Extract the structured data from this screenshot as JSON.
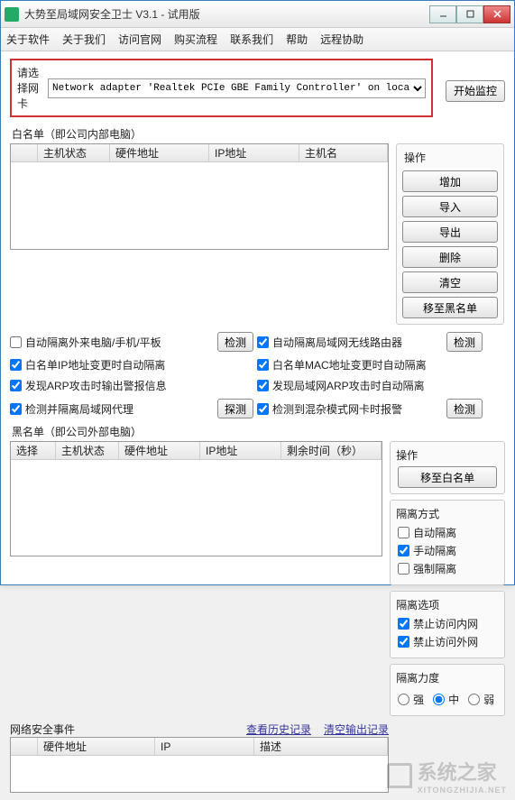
{
  "window": {
    "title": "大势至局域网安全卫士 V3.1 - 试用版"
  },
  "menu": [
    "关于软件",
    "关于我们",
    "访问官网",
    "购买流程",
    "联系我们",
    "帮助",
    "远程协助"
  ],
  "adapter": {
    "label": "请选择网卡",
    "selected": "Network adapter 'Realtek PCIe GBE Family Controller' on loca",
    "start_btn": "开始监控"
  },
  "whitelist": {
    "label": "白名单（即公司内部电脑）",
    "columns": [
      "主机状态",
      "硬件地址",
      "IP地址",
      "主机名"
    ],
    "ops_title": "操作",
    "ops": [
      "增加",
      "导入",
      "导出",
      "删除",
      "清空",
      "移至黑名单"
    ]
  },
  "options": [
    {
      "checked": false,
      "text": "自动隔离外来电脑/手机/平板",
      "btn": "检测"
    },
    {
      "checked": true,
      "text": "自动隔离局域网无线路由器",
      "btn": "检测"
    },
    {
      "checked": true,
      "text": "白名单IP地址变更时自动隔离"
    },
    {
      "checked": true,
      "text": "白名单MAC地址变更时自动隔离"
    },
    {
      "checked": true,
      "text": "发现ARP攻击时输出警报信息"
    },
    {
      "checked": true,
      "text": "发现局域网ARP攻击时自动隔离"
    },
    {
      "checked": true,
      "text": "检测并隔离局域网代理",
      "btn": "探测"
    },
    {
      "checked": true,
      "text": "检测到混杂模式网卡时报警",
      "btn": "检测"
    }
  ],
  "blacklist": {
    "label": "黑名单（即公司外部电脑）",
    "columns": [
      "选择",
      "主机状态",
      "硬件地址",
      "IP地址",
      "剩余时间（秒）"
    ],
    "ops_title": "操作",
    "move_btn": "移至白名单"
  },
  "iso_mode": {
    "title": "隔离方式",
    "items": [
      {
        "checked": false,
        "text": "自动隔离"
      },
      {
        "checked": true,
        "text": "手动隔离"
      },
      {
        "checked": false,
        "text": "强制隔离"
      }
    ]
  },
  "iso_opts": {
    "title": "隔离选项",
    "items": [
      {
        "checked": true,
        "text": "禁止访问内网"
      },
      {
        "checked": true,
        "text": "禁止访问外网"
      }
    ]
  },
  "iso_level": {
    "title": "隔离力度",
    "items": [
      "强",
      "中",
      "弱"
    ],
    "selected": "中"
  },
  "events": {
    "label": "网络安全事件",
    "links": [
      "查看历史记录",
      "清空输出记录"
    ],
    "columns": [
      "硬件地址",
      "IP",
      "描述"
    ]
  },
  "watermark": {
    "main": "系统之家",
    "sub": "XITONGZHIJIA.NET"
  }
}
